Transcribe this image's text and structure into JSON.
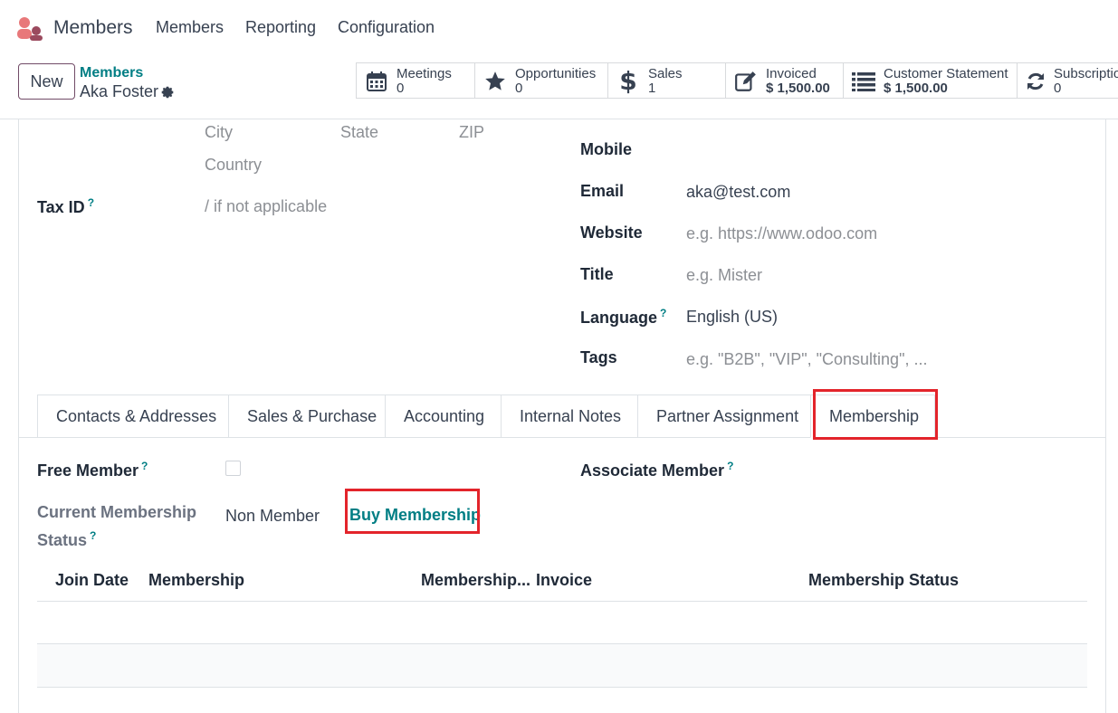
{
  "navbar": {
    "app_name": "Members",
    "menus": [
      "Members",
      "Reporting",
      "Configuration"
    ]
  },
  "control": {
    "new_label": "New",
    "breadcrumb": "Members",
    "record_name": "Aka Foster"
  },
  "smart_buttons": [
    {
      "label": "Meetings",
      "value": "0",
      "icon": "calendar-icon"
    },
    {
      "label": "Opportunities",
      "value": "0",
      "icon": "star-icon"
    },
    {
      "label": "Sales",
      "value": "1",
      "icon": "dollar-icon"
    },
    {
      "label": "Invoiced",
      "value": "$ 1,500.00",
      "icon": "invoice-edit-icon"
    },
    {
      "label": "Customer Statement",
      "value": "$ 1,500.00",
      "icon": "list-icon"
    },
    {
      "label": "Subscriptio",
      "value": "0",
      "icon": "refresh-icon"
    }
  ],
  "address": {
    "city_placeholder": "City",
    "state_placeholder": "State",
    "zip_placeholder": "ZIP",
    "country_placeholder": "Country"
  },
  "tax": {
    "label": "Tax ID",
    "help": "?",
    "placeholder": "/ if not applicable"
  },
  "contact_fields": {
    "mobile_label": "Mobile",
    "email_label": "Email",
    "email_value": "aka@test.com",
    "website_label": "Website",
    "website_placeholder": "e.g. https://www.odoo.com",
    "title_label": "Title",
    "title_placeholder": "e.g. Mister",
    "language_label": "Language",
    "language_value": "English (US)",
    "tags_label": "Tags",
    "tags_placeholder": "e.g. \"B2B\", \"VIP\", \"Consulting\", ..."
  },
  "tabs": [
    "Contacts & Addresses",
    "Sales & Purchase",
    "Accounting",
    "Internal Notes",
    "Partner Assignment",
    "Membership"
  ],
  "membership": {
    "free_member_label": "Free Member",
    "associate_member_label": "Associate Member",
    "status_label_line1": "Current Membership",
    "status_label_line2": "Status",
    "status_value": "Non Member",
    "buy_label": "Buy Membership",
    "help": "?"
  },
  "table": {
    "headers": [
      "Join Date",
      "Membership",
      "Membership...",
      "Invoice",
      "Membership Status"
    ]
  },
  "colors": {
    "accent": "#017e84",
    "brand": "#714b67",
    "highlight": "#e3242b"
  }
}
